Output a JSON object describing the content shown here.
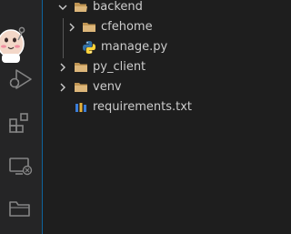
{
  "explorer": {
    "items": [
      {
        "label": "backend",
        "type": "folder",
        "expanded": true
      },
      {
        "label": "cfehome",
        "type": "folder",
        "expanded": false
      },
      {
        "label": "manage.py",
        "type": "python-file"
      },
      {
        "label": "py_client",
        "type": "folder",
        "expanded": false
      },
      {
        "label": "venv",
        "type": "folder",
        "expanded": false
      },
      {
        "label": "requirements.txt",
        "type": "text-file"
      }
    ]
  },
  "activity_bar": {
    "icons": [
      "mascot-sticker-icon",
      "run-debug-icon",
      "extensions-icon",
      "remote-explorer-icon",
      "folder-icon"
    ]
  },
  "colors": {
    "background": "#1e1e1e",
    "activity_bar": "#252526",
    "accent_border": "#0e639c",
    "text": "#cccccc",
    "folder": "#c09553",
    "python_blue": "#3572A5",
    "python_yellow": "#ffd43b"
  }
}
